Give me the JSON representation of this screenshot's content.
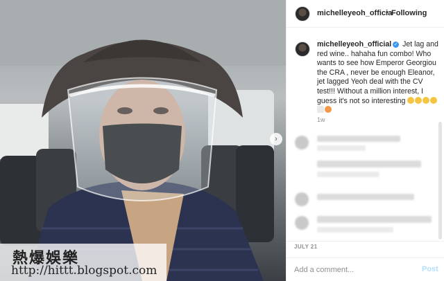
{
  "post": {
    "header": {
      "username": "michelleyeoh_officia",
      "separator": "•",
      "follow_label": "Following"
    },
    "caption": {
      "username": "michelleyeoh_official",
      "text": "Jet lag and red wine.. hahaha fun combo! Who wants to see how Emperor Georgiou the CRA , never be enough Eleanor, jet lagged Yeoh deal with the CV test!!! Without a million interest, I guess it's not so interesting",
      "age": "1w"
    },
    "date": "JULY 21",
    "comment_box": {
      "placeholder": "Add a comment...",
      "post_label": "Post"
    },
    "carousel_arrow_icon": "chevron-right-icon",
    "verified_icon": "verified-badge-icon"
  },
  "watermark": {
    "title": "熱爆娛樂",
    "url": "http://hittt.blogspot.com"
  },
  "colors": {
    "link_blue": "#3897f0",
    "post_disabled": "#b2dffc",
    "muted": "#8e8e8e"
  }
}
